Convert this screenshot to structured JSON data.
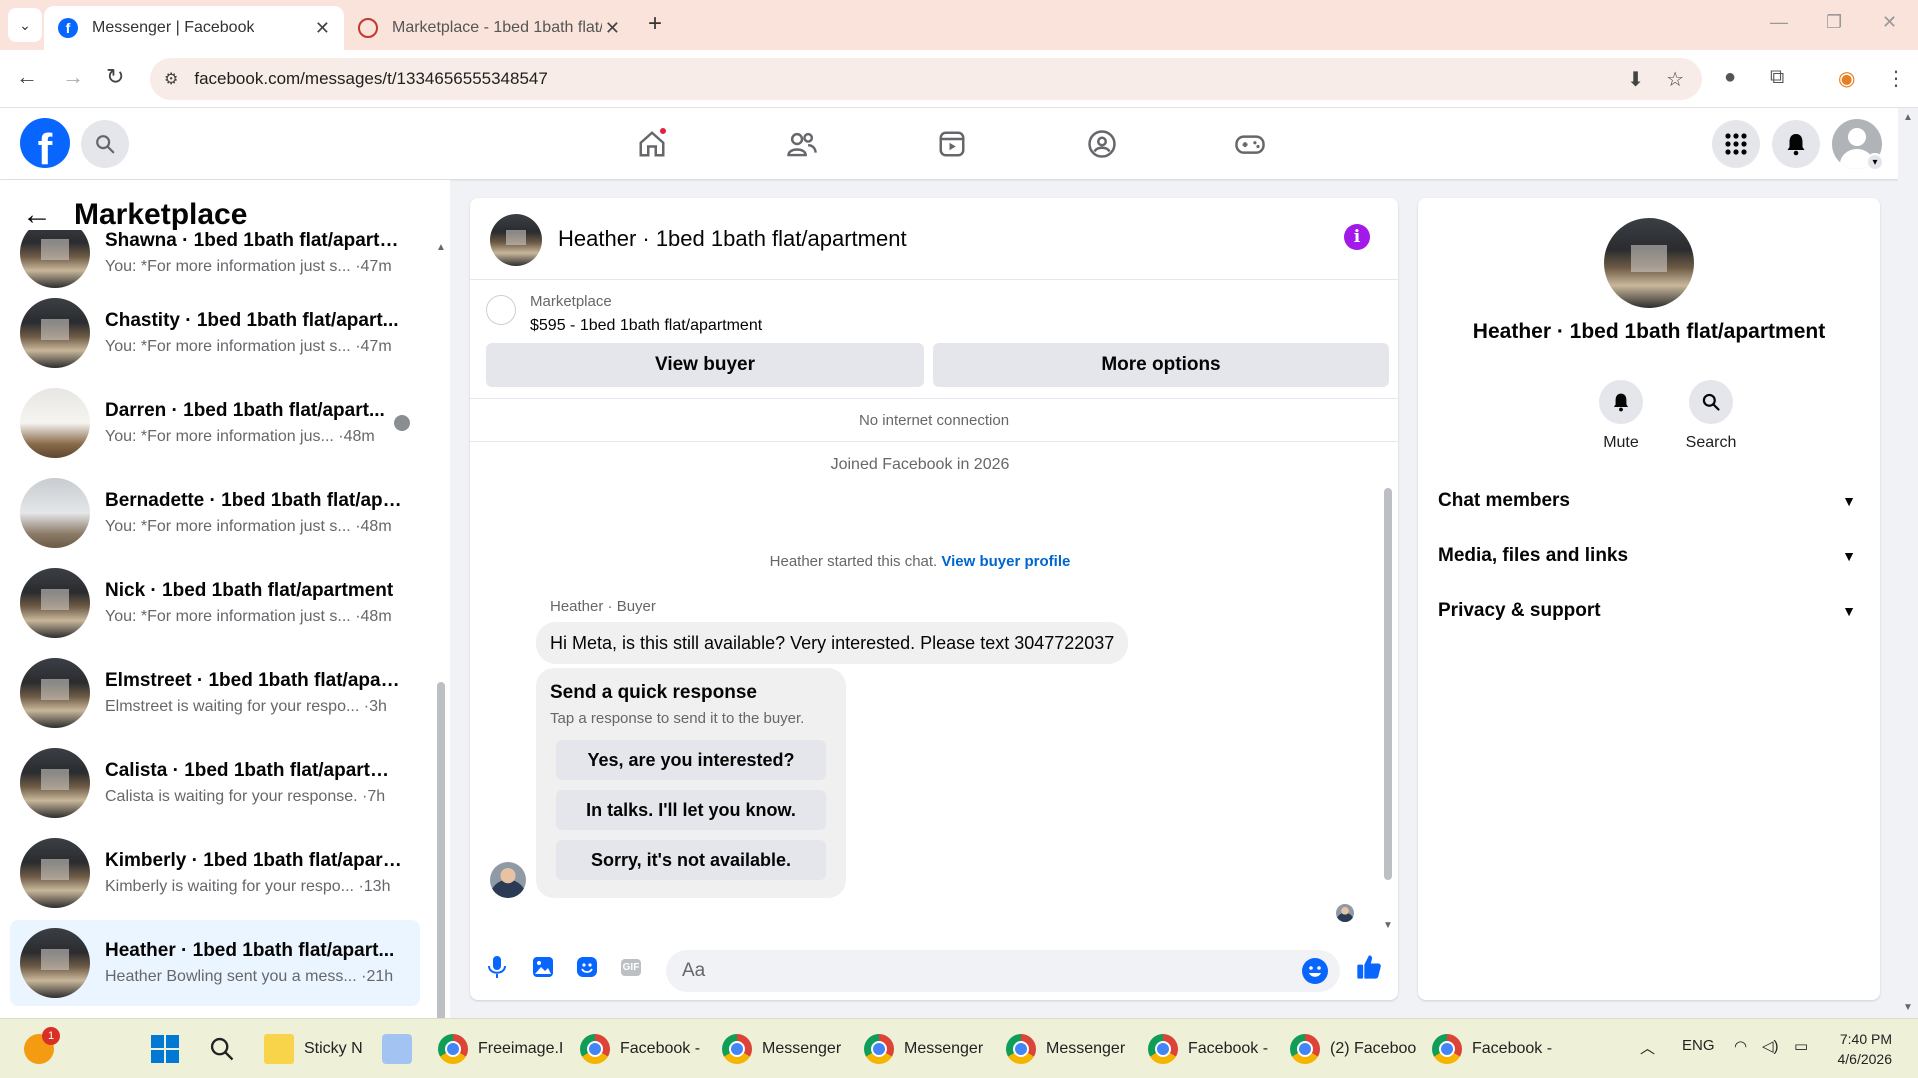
{
  "browser": {
    "tabs": [
      {
        "title": "Messenger | Facebook",
        "active": true
      },
      {
        "title": "Marketplace - 1bed 1bath flat/a",
        "active": false
      }
    ],
    "url": "facebook.com/messages/t/1334656555348547"
  },
  "sidebar": {
    "title": "Marketplace",
    "conversations": [
      {
        "name": "Shawna · 1bed 1bath flat/apartm...",
        "preview": "You: *For more information just s...",
        "time": "·47m",
        "thumb": "kitchen"
      },
      {
        "name": "Chastity · 1bed 1bath flat/apart...",
        "preview": "You: *For more information just s...",
        "time": "·47m",
        "thumb": "kitchen"
      },
      {
        "name": "Darren · 1bed 1bath flat/apart...",
        "preview": "You: *For more information jus...",
        "time": "·48m",
        "thumb": "room"
      },
      {
        "name": "Bernadette · 1bed 1bath flat/apa...",
        "preview": "You: *For more information just s...",
        "time": "·48m",
        "thumb": "room2"
      },
      {
        "name": "Nick · 1bed 1bath flat/apartment",
        "preview": "You: *For more information just s...",
        "time": "·48m",
        "thumb": "kitchen"
      },
      {
        "name": "Elmstreet · 1bed 1bath flat/apart...",
        "preview": "Elmstreet is waiting for your respo...",
        "time": "·3h",
        "thumb": "kitchen"
      },
      {
        "name": "Calista · 1bed 1bath flat/apartme...",
        "preview": "Calista is waiting for your response.",
        "time": "·7h",
        "thumb": "kitchen"
      },
      {
        "name": "Kimberly · 1bed 1bath flat/apart...",
        "preview": "Kimberly is waiting for your respo...",
        "time": "·13h",
        "thumb": "kitchen"
      },
      {
        "name": "Heather · 1bed 1bath flat/apart...",
        "preview": "Heather Bowling sent you a mess...",
        "time": "·21h",
        "thumb": "kitchen",
        "selected": true
      }
    ]
  },
  "chat": {
    "title": "Heather · 1bed 1bath flat/apartment",
    "listing_label": "Marketplace",
    "listing_price": "$595 - 1bed 1bath flat/apartment",
    "view_buyer": "View buyer",
    "more_options": "More options",
    "no_connection": "No internet connection",
    "joined": "Joined Facebook in 2026",
    "started": "Heather started this chat.",
    "view_profile": "View buyer profile",
    "sender": "Heather · Buyer",
    "message": "Hi Meta, is this still available? Very interested. Please text 3047722037",
    "quick_title": "Send a quick response",
    "quick_sub": "Tap a response to send it to the buyer.",
    "quick_responses": [
      "Yes, are you interested?",
      "In talks. I'll let you know.",
      "Sorry, it's not available."
    ],
    "composer_placeholder": "Aa"
  },
  "details": {
    "name": "Heather · 1bed 1bath flat/apartment",
    "mute": "Mute",
    "search": "Search",
    "sections": [
      "Chat members",
      "Media, files and links",
      "Privacy & support"
    ]
  },
  "taskbar": {
    "notification_count": "1",
    "items": [
      "Sticky N",
      "Freeimage.I",
      "Facebook -",
      "Messenger",
      "Messenger",
      "Messenger",
      "Facebook -",
      "(2) Faceboo",
      "Facebook -"
    ],
    "language": "ENG",
    "time": "7:40 PM",
    "date": "4/6/2026"
  },
  "colors": {
    "fb_blue": "#0866ff",
    "info_purple": "#a219e9",
    "tabbar": "#f9e3da"
  }
}
